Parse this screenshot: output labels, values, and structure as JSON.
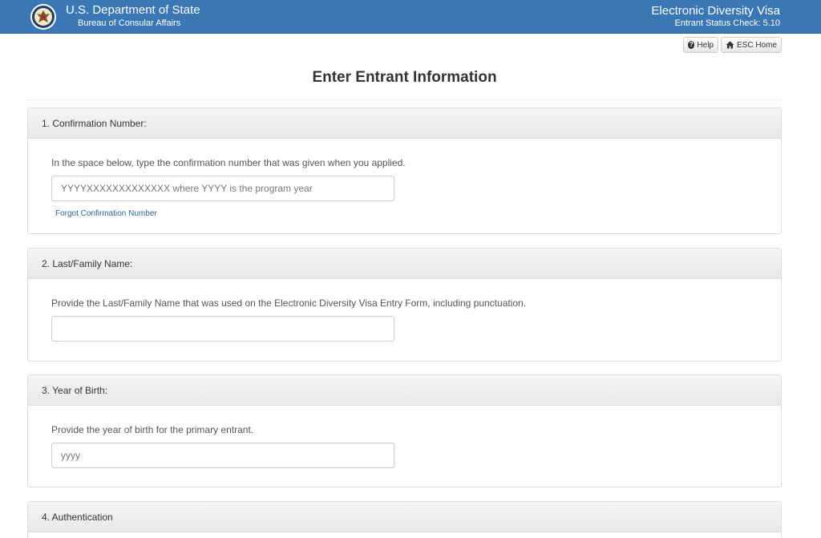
{
  "header": {
    "agency_title": "U.S. Department of State",
    "agency_subtitle": "Bureau of Consular Affairs",
    "app_title": "Electronic Diversity Visa",
    "app_subtitle": "Entrant Status Check: 5.10",
    "background_color": "#3a77b5"
  },
  "toolbar": {
    "help_label": "Help",
    "home_label": "ESC Home",
    "help_icon": "question-circle-icon",
    "home_icon": "home-icon"
  },
  "page": {
    "title": "Enter Entrant Information"
  },
  "sections": {
    "confirmation": {
      "heading": "1. Confirmation Number:",
      "instructions": "In the space below, type the confirmation number that was given when you applied.",
      "placeholder": "YYYYXXXXXXXXXXXXX where YYYY is the program year",
      "value": "",
      "link": "Forgot Confirmation Number"
    },
    "last_name": {
      "heading": "2. Last/Family Name:",
      "instructions": "Provide the Last/Family Name that was used on the Electronic Diversity Visa Entry Form, including punctuation.",
      "placeholder": "",
      "value": ""
    },
    "birth_year": {
      "heading": "3. Year of Birth:",
      "instructions": "Provide the year of birth for the primary entrant.",
      "placeholder": "yyyy",
      "value": ""
    },
    "authentication": {
      "heading": "4. Authentication"
    }
  }
}
